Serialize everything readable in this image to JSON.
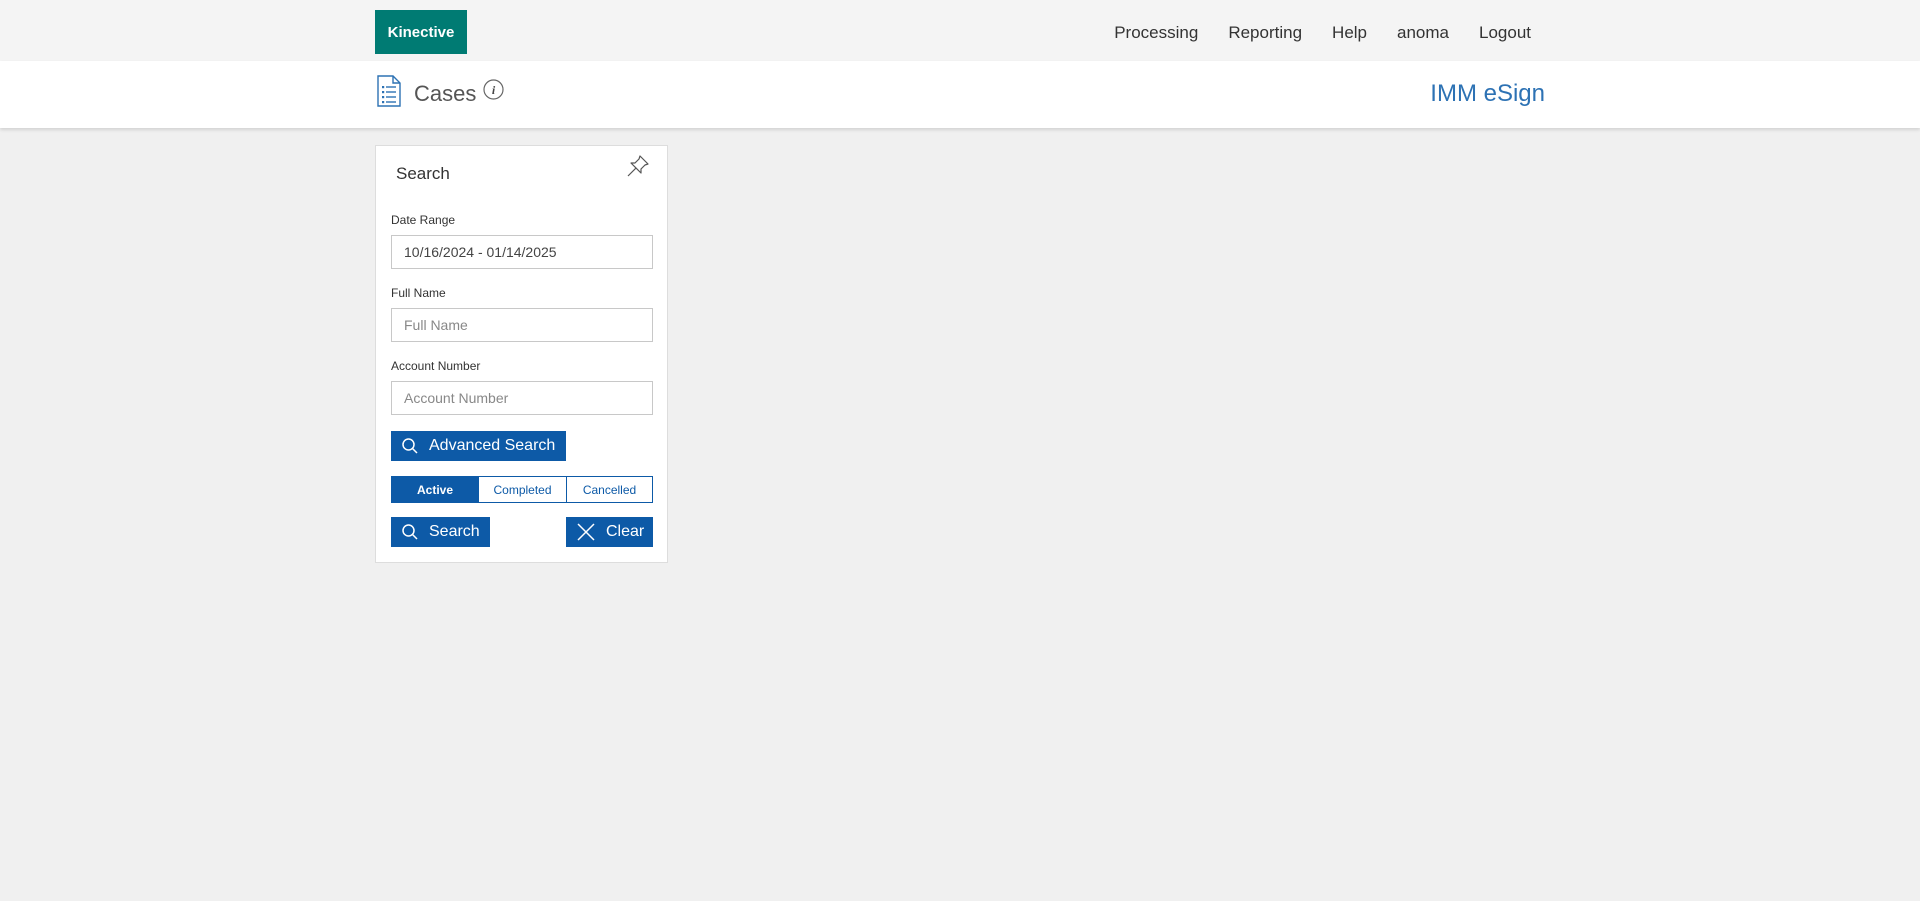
{
  "brand": {
    "logo_text": "Kinective"
  },
  "nav": {
    "items": [
      {
        "label": "Processing"
      },
      {
        "label": "Reporting"
      },
      {
        "label": "Help"
      },
      {
        "label": "anoma"
      },
      {
        "label": "Logout"
      }
    ]
  },
  "header": {
    "title": "Cases",
    "app_name": "IMM eSign",
    "icons": [
      "list-document-icon",
      "info-icon"
    ]
  },
  "search_panel": {
    "title": "Search",
    "pin_icon": "pin-icon",
    "date_range": {
      "label": "Date Range",
      "value": "10/16/2024 - 01/14/2025"
    },
    "full_name": {
      "label": "Full Name",
      "placeholder": "Full Name",
      "value": ""
    },
    "account_number": {
      "label": "Account Number",
      "placeholder": "Account Number",
      "value": ""
    },
    "advanced_search_label": "Advanced Search",
    "status_tabs": [
      {
        "label": "Active",
        "selected": true
      },
      {
        "label": "Completed",
        "selected": false
      },
      {
        "label": "Cancelled",
        "selected": false
      }
    ],
    "search_label": "Search",
    "clear_label": "Clear"
  },
  "colors": {
    "brand_teal": "#007b73",
    "primary_blue": "#0d5aa7",
    "app_name_blue": "#2d72b4",
    "background": "#f0f0f0"
  }
}
